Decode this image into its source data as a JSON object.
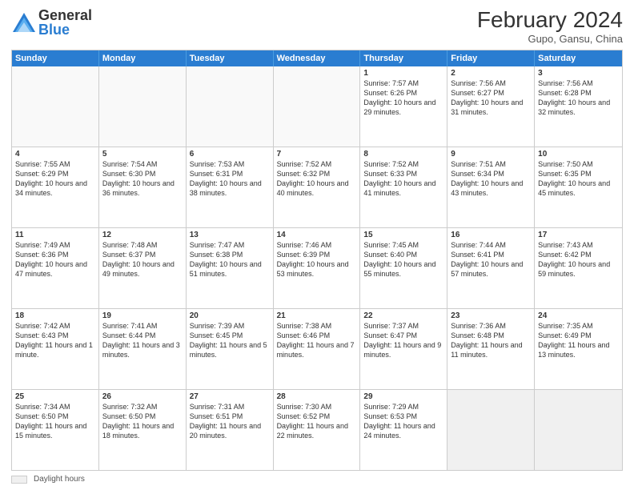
{
  "header": {
    "logo_general": "General",
    "logo_blue": "Blue",
    "main_title": "February 2024",
    "subtitle": "Gupo, Gansu, China"
  },
  "calendar": {
    "days_of_week": [
      "Sunday",
      "Monday",
      "Tuesday",
      "Wednesday",
      "Thursday",
      "Friday",
      "Saturday"
    ],
    "weeks": [
      [
        {
          "day": "",
          "text": "",
          "empty": true
        },
        {
          "day": "",
          "text": "",
          "empty": true
        },
        {
          "day": "",
          "text": "",
          "empty": true
        },
        {
          "day": "",
          "text": "",
          "empty": true
        },
        {
          "day": "1",
          "text": "Sunrise: 7:57 AM\nSunset: 6:26 PM\nDaylight: 10 hours and 29 minutes."
        },
        {
          "day": "2",
          "text": "Sunrise: 7:56 AM\nSunset: 6:27 PM\nDaylight: 10 hours and 31 minutes."
        },
        {
          "day": "3",
          "text": "Sunrise: 7:56 AM\nSunset: 6:28 PM\nDaylight: 10 hours and 32 minutes."
        }
      ],
      [
        {
          "day": "4",
          "text": "Sunrise: 7:55 AM\nSunset: 6:29 PM\nDaylight: 10 hours and 34 minutes."
        },
        {
          "day": "5",
          "text": "Sunrise: 7:54 AM\nSunset: 6:30 PM\nDaylight: 10 hours and 36 minutes."
        },
        {
          "day": "6",
          "text": "Sunrise: 7:53 AM\nSunset: 6:31 PM\nDaylight: 10 hours and 38 minutes."
        },
        {
          "day": "7",
          "text": "Sunrise: 7:52 AM\nSunset: 6:32 PM\nDaylight: 10 hours and 40 minutes."
        },
        {
          "day": "8",
          "text": "Sunrise: 7:52 AM\nSunset: 6:33 PM\nDaylight: 10 hours and 41 minutes."
        },
        {
          "day": "9",
          "text": "Sunrise: 7:51 AM\nSunset: 6:34 PM\nDaylight: 10 hours and 43 minutes."
        },
        {
          "day": "10",
          "text": "Sunrise: 7:50 AM\nSunset: 6:35 PM\nDaylight: 10 hours and 45 minutes."
        }
      ],
      [
        {
          "day": "11",
          "text": "Sunrise: 7:49 AM\nSunset: 6:36 PM\nDaylight: 10 hours and 47 minutes."
        },
        {
          "day": "12",
          "text": "Sunrise: 7:48 AM\nSunset: 6:37 PM\nDaylight: 10 hours and 49 minutes."
        },
        {
          "day": "13",
          "text": "Sunrise: 7:47 AM\nSunset: 6:38 PM\nDaylight: 10 hours and 51 minutes."
        },
        {
          "day": "14",
          "text": "Sunrise: 7:46 AM\nSunset: 6:39 PM\nDaylight: 10 hours and 53 minutes."
        },
        {
          "day": "15",
          "text": "Sunrise: 7:45 AM\nSunset: 6:40 PM\nDaylight: 10 hours and 55 minutes."
        },
        {
          "day": "16",
          "text": "Sunrise: 7:44 AM\nSunset: 6:41 PM\nDaylight: 10 hours and 57 minutes."
        },
        {
          "day": "17",
          "text": "Sunrise: 7:43 AM\nSunset: 6:42 PM\nDaylight: 10 hours and 59 minutes."
        }
      ],
      [
        {
          "day": "18",
          "text": "Sunrise: 7:42 AM\nSunset: 6:43 PM\nDaylight: 11 hours and 1 minute."
        },
        {
          "day": "19",
          "text": "Sunrise: 7:41 AM\nSunset: 6:44 PM\nDaylight: 11 hours and 3 minutes."
        },
        {
          "day": "20",
          "text": "Sunrise: 7:39 AM\nSunset: 6:45 PM\nDaylight: 11 hours and 5 minutes."
        },
        {
          "day": "21",
          "text": "Sunrise: 7:38 AM\nSunset: 6:46 PM\nDaylight: 11 hours and 7 minutes."
        },
        {
          "day": "22",
          "text": "Sunrise: 7:37 AM\nSunset: 6:47 PM\nDaylight: 11 hours and 9 minutes."
        },
        {
          "day": "23",
          "text": "Sunrise: 7:36 AM\nSunset: 6:48 PM\nDaylight: 11 hours and 11 minutes."
        },
        {
          "day": "24",
          "text": "Sunrise: 7:35 AM\nSunset: 6:49 PM\nDaylight: 11 hours and 13 minutes."
        }
      ],
      [
        {
          "day": "25",
          "text": "Sunrise: 7:34 AM\nSunset: 6:50 PM\nDaylight: 11 hours and 15 minutes."
        },
        {
          "day": "26",
          "text": "Sunrise: 7:32 AM\nSunset: 6:50 PM\nDaylight: 11 hours and 18 minutes."
        },
        {
          "day": "27",
          "text": "Sunrise: 7:31 AM\nSunset: 6:51 PM\nDaylight: 11 hours and 20 minutes."
        },
        {
          "day": "28",
          "text": "Sunrise: 7:30 AM\nSunset: 6:52 PM\nDaylight: 11 hours and 22 minutes."
        },
        {
          "day": "29",
          "text": "Sunrise: 7:29 AM\nSunset: 6:53 PM\nDaylight: 11 hours and 24 minutes."
        },
        {
          "day": "",
          "text": "",
          "empty": true,
          "shaded": true
        },
        {
          "day": "",
          "text": "",
          "empty": true,
          "shaded": true
        }
      ]
    ]
  },
  "legend": {
    "label": "Daylight hours"
  }
}
